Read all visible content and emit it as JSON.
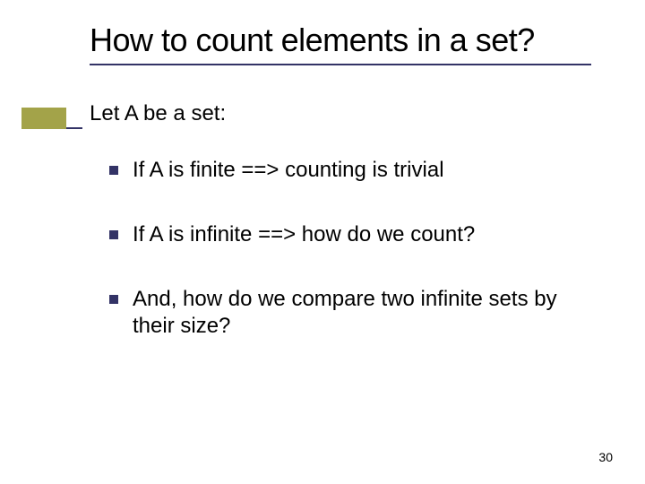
{
  "title": "How to count elements in a set?",
  "intro": "Let A be a set:",
  "bullets": [
    "If A is finite  ==> counting is trivial",
    "If A is infinite ==> how do we count?",
    "And, how do we compare two infinite sets by their size?"
  ],
  "pageNumber": "30"
}
